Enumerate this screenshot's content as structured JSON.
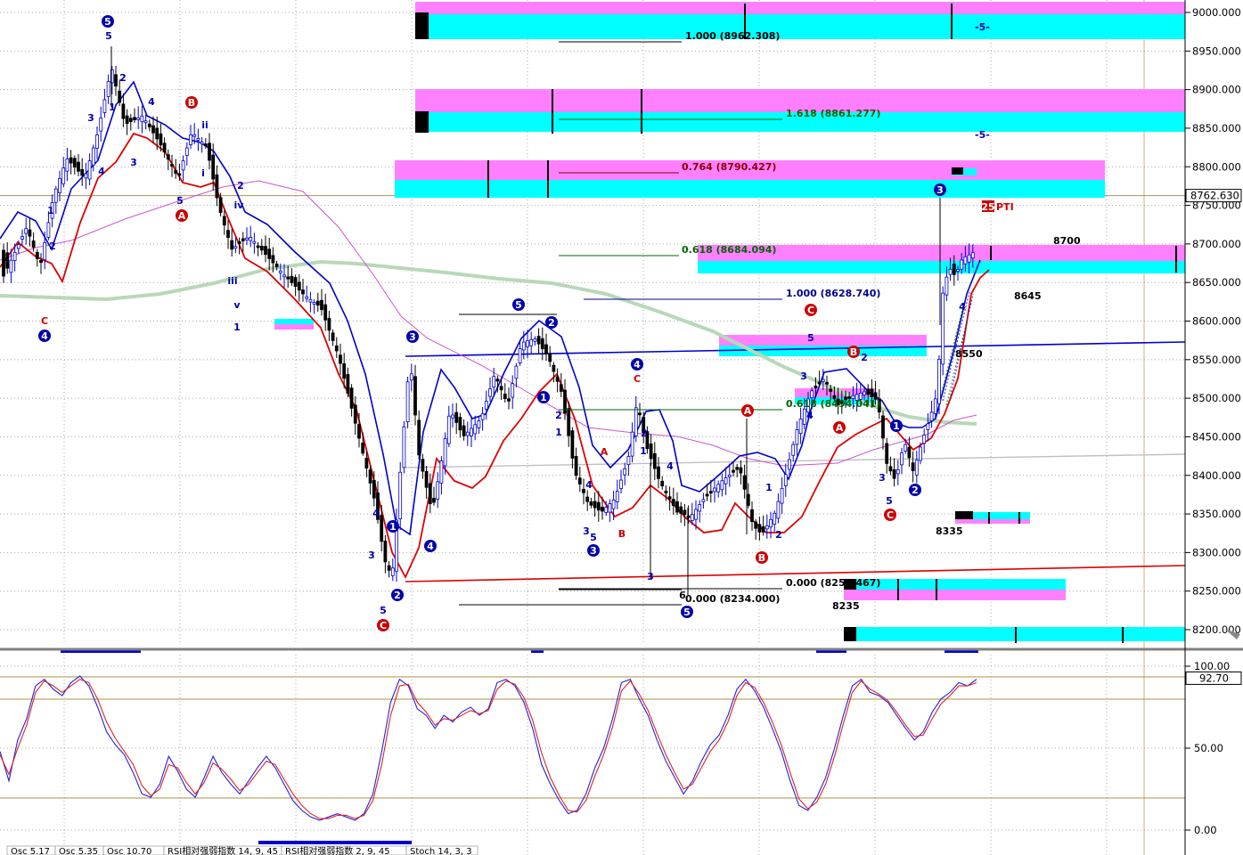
{
  "chart_data": [
    {
      "type": "candlestick",
      "price_axis": {
        "ticks": [
          "9000.000",
          "8950.000",
          "8900.000",
          "8850.000",
          "8800.000",
          "8750.000",
          "8700.000",
          "8650.000",
          "8600.000",
          "8550.000",
          "8500.000",
          "8450.000",
          "8400.000",
          "8350.000",
          "8300.000",
          "8250.000",
          "8200.000"
        ],
        "tick_values": [
          9000,
          8950,
          8900,
          8850,
          8800,
          8750,
          8700,
          8650,
          8600,
          8550,
          8500,
          8450,
          8400,
          8350,
          8300,
          8250,
          8200
        ],
        "ylim": [
          8190,
          9012
        ],
        "current_price_label": "8762.630",
        "current_price": 8762.63
      },
      "grid": "dotted",
      "fibonacci_levels": [
        {
          "label": "1.000 (8962.308)",
          "value": 8962.308,
          "color": "#000000"
        },
        {
          "label": "1.618 (8861.277)",
          "value": 8861.277,
          "color": "#006400"
        },
        {
          "label": "0.764 (8790.427)",
          "value": 8790.427,
          "color": "#8b0000"
        },
        {
          "label": "0.618 (8684.094)",
          "value": 8684.094,
          "color": "#006400"
        },
        {
          "label": "1.000 (8628.740)",
          "value": 8628.74,
          "color": "#00008b"
        },
        {
          "label": "0.618 (8494.041)",
          "value": 8494.041,
          "color": "#006400"
        },
        {
          "label": "0.000 (8252.467)",
          "value": 8252.467,
          "color": "#000000"
        },
        {
          "label": "0.000 (8234.000)",
          "value": 8234.0,
          "color": "#000000"
        }
      ],
      "price_annotations": [
        {
          "text": "8700",
          "value": 8700
        },
        {
          "text": "8645",
          "value": 8645
        },
        {
          "text": "8550",
          "value": 8550
        },
        {
          "text": "8335",
          "value": 8335
        },
        {
          "text": "8235",
          "value": 8235
        },
        {
          "text": "-5-",
          "value": 8962
        },
        {
          "text": "-5-",
          "value": 8848
        }
      ],
      "indicator_tag": "25",
      "indicator_text": "PTI",
      "wave_labels": [
        "5",
        "C",
        "B",
        "A",
        "3",
        "4",
        "2",
        "1",
        "ii",
        "i",
        "iii",
        "v",
        "iv"
      ],
      "colors": {
        "bull_candle": "#0000cc",
        "bear_candle": "#000000",
        "upper_band": "#0000cc",
        "lower_band": "#dd0000",
        "ma_long": "#b8d8b8",
        "ma_magenta": "#cc55cc",
        "zone_magenta": "#ff80ff",
        "zone_cyan": "#00ffff"
      }
    },
    {
      "type": "line",
      "name": "Stochastic",
      "y_ticks": [
        "100.00",
        "50.00",
        "0.00"
      ],
      "tick_values": [
        100,
        50,
        0
      ],
      "current_value_label": "92.70",
      "current_value": 92.7,
      "ylim": [
        -5,
        108
      ],
      "series": [
        {
          "values": [
            48,
            30,
            55,
            68,
            88,
            92,
            86,
            82,
            90,
            94,
            88,
            75,
            60,
            52,
            46,
            35,
            22,
            20,
            28,
            45,
            36,
            25,
            20,
            32,
            45,
            35,
            28,
            22,
            30,
            38,
            45,
            38,
            28,
            18,
            12,
            8,
            6,
            8,
            10,
            8,
            6,
            10,
            22,
            48,
            78,
            92,
            88,
            74,
            70,
            62,
            70,
            66,
            72,
            75,
            70,
            74,
            90,
            92,
            88,
            78,
            62,
            40,
            28,
            18,
            10,
            12,
            22,
            38,
            50,
            68,
            90,
            92,
            80,
            70,
            55,
            42,
            32,
            22,
            30,
            42,
            52,
            58,
            70,
            86,
            92,
            85,
            75,
            62,
            48,
            30,
            15,
            12,
            20,
            32,
            50,
            70,
            88,
            92,
            84,
            82,
            78,
            70,
            62,
            55,
            60,
            72,
            80,
            84,
            90,
            88,
            92
          ]
        },
        {
          "values": [
            46,
            34,
            50,
            64,
            84,
            91,
            88,
            84,
            88,
            92,
            90,
            80,
            66,
            56,
            48,
            40,
            27,
            21,
            25,
            40,
            38,
            29,
            22,
            29,
            41,
            37,
            31,
            24,
            28,
            35,
            42,
            40,
            31,
            22,
            15,
            10,
            7,
            7,
            9,
            9,
            7,
            9,
            18,
            40,
            70,
            88,
            89,
            78,
            72,
            64,
            68,
            67,
            70,
            73,
            71,
            73,
            86,
            91,
            89,
            81,
            67,
            47,
            32,
            21,
            12,
            11,
            18,
            33,
            46,
            63,
            85,
            91,
            83,
            73,
            59,
            46,
            35,
            25,
            28,
            38,
            48,
            55,
            66,
            82,
            90,
            87,
            78,
            66,
            52,
            35,
            19,
            13,
            17,
            28,
            45,
            65,
            84,
            91,
            86,
            83,
            79,
            72,
            64,
            57,
            58,
            68,
            77,
            82,
            88,
            88,
            90
          ]
        }
      ]
    }
  ],
  "bottom_tabs": [
    "Osc 5.17",
    "Osc 5.35",
    "Osc 10.70",
    "RSI相对强弱指数 14, 9, 45",
    "RSI相对强弱指数 2, 9, 45",
    "Stoch 14, 3, 3"
  ]
}
